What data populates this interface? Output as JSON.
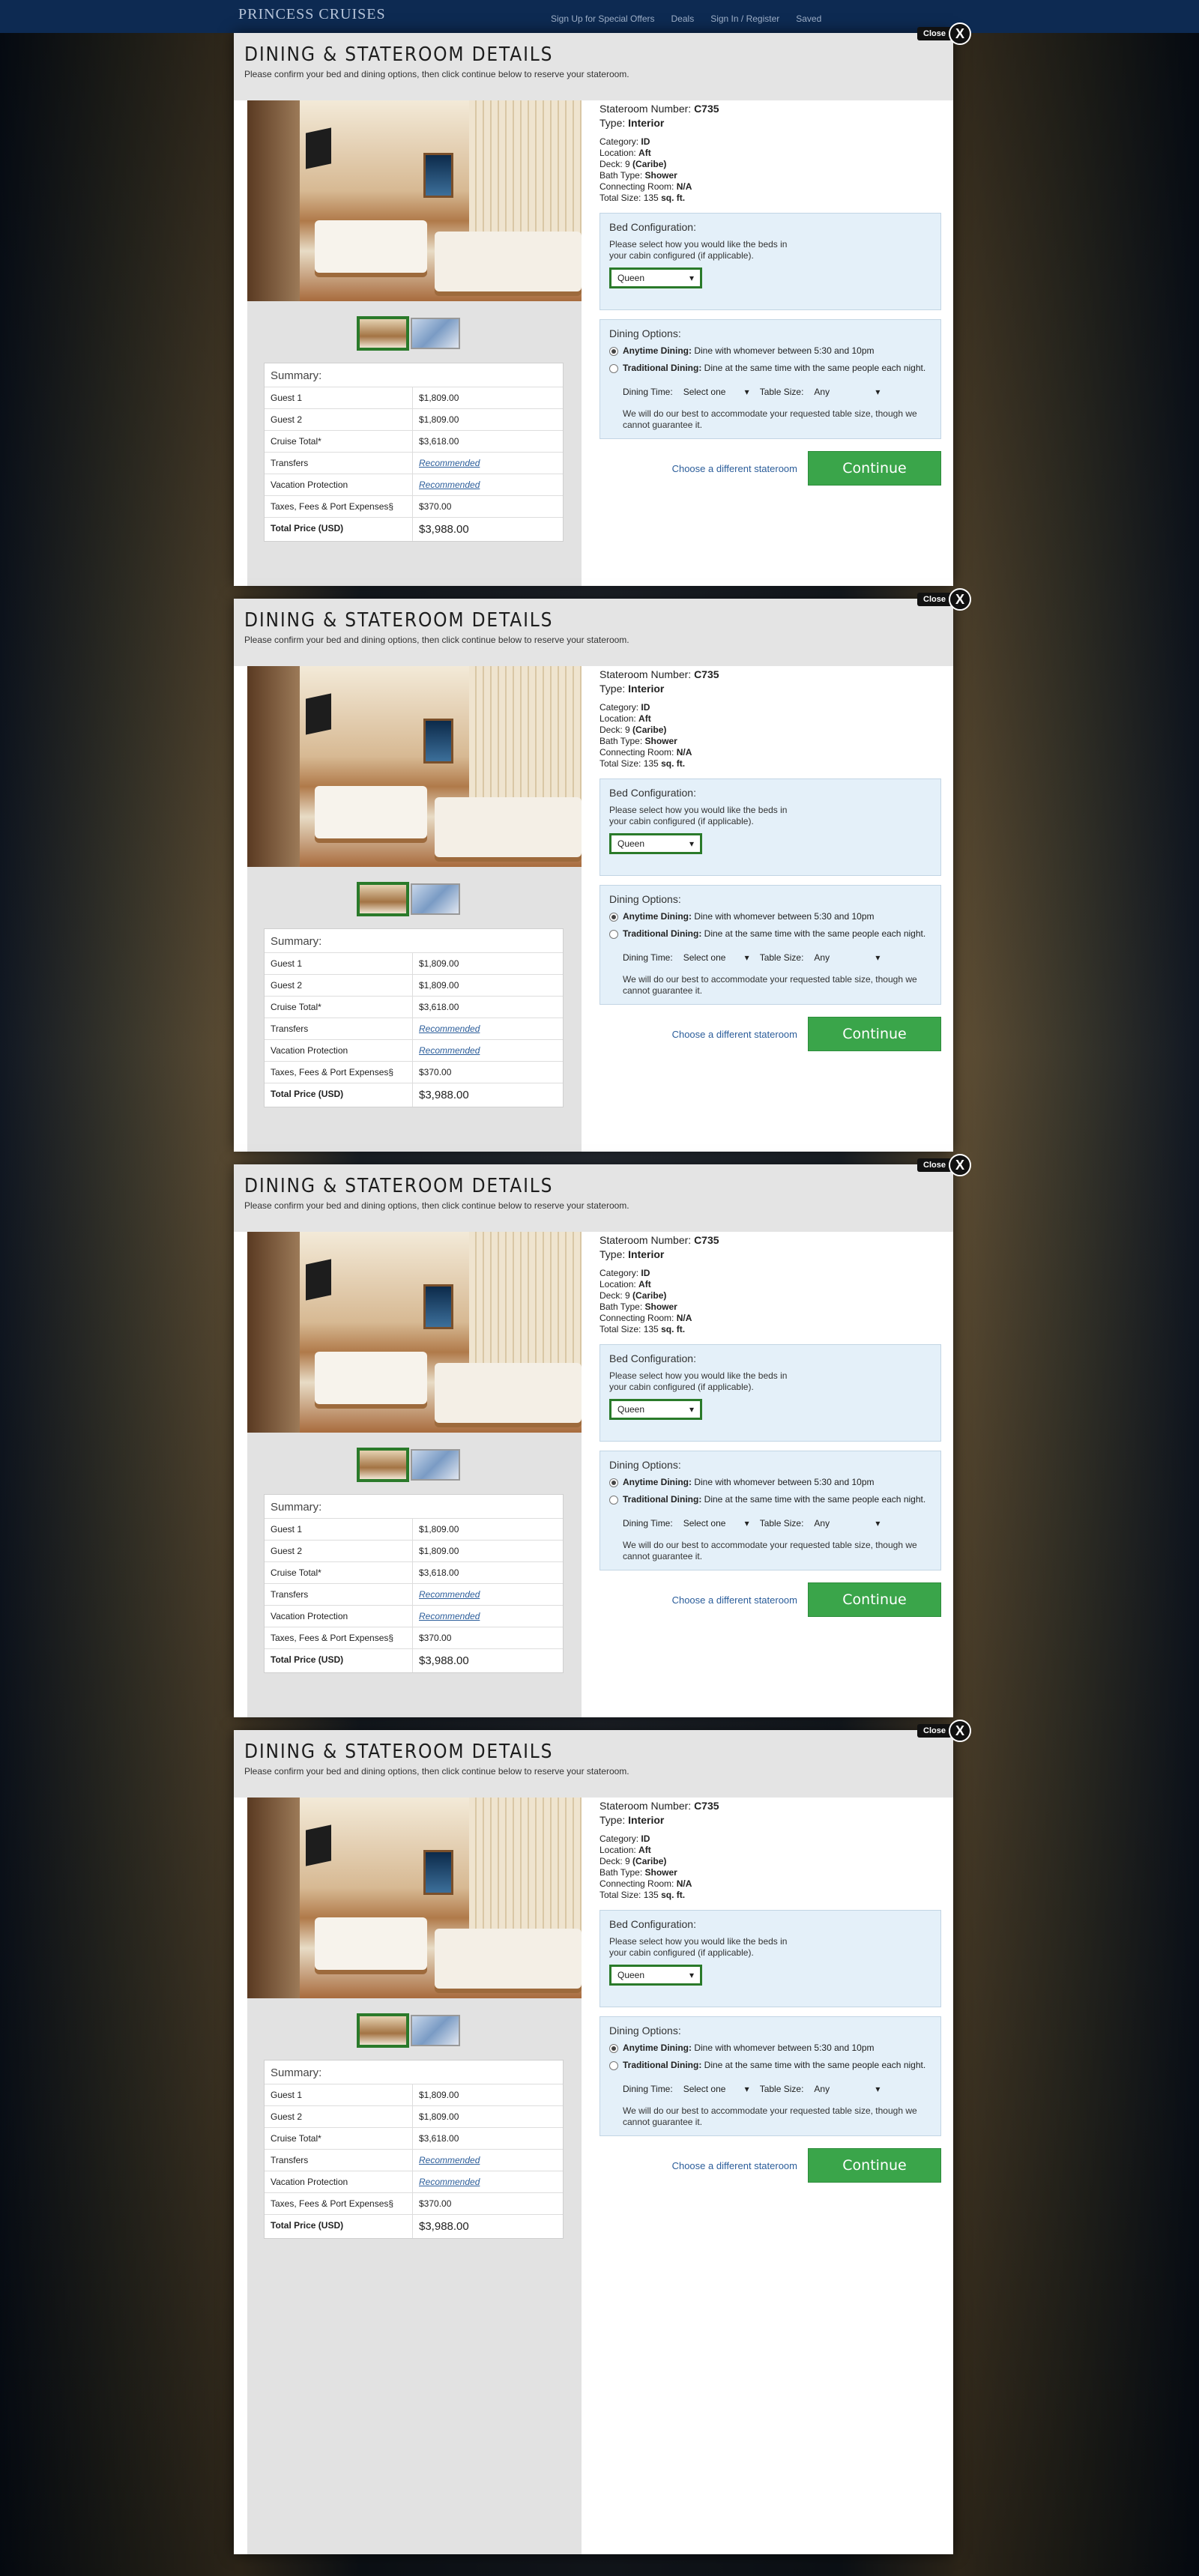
{
  "site": {
    "logo": "PRINCESS CRUISES",
    "links": [
      "Sign Up for Special Offers",
      "Deals",
      "Sign In / Register",
      "Saved"
    ]
  },
  "modal": {
    "title": "DINING & STATEROOM DETAILS",
    "subtitle": "Please confirm your bed and dining options, then click continue below to reserve your stateroom.",
    "close_label": "Close",
    "close_x": "X"
  },
  "stateroom": {
    "number_label": "Stateroom Number:",
    "number": "C735",
    "type_label": "Type:",
    "type": "Interior",
    "category_label": "Category:",
    "category": "ID",
    "location_label": "Location:",
    "location": "Aft",
    "deck_label": "Deck: 9",
    "deck": "(Caribe)",
    "bath_label": "Bath Type:",
    "bath": "Shower",
    "connecting_label": "Connecting Room:",
    "connecting": "N/A",
    "size_label": "Total Size: 135",
    "size_unit": "sq. ft."
  },
  "bed": {
    "heading": "Bed Configuration:",
    "text": "Please select how you would like the beds in your cabin configured (if applicable).",
    "selected": "Queen"
  },
  "dining": {
    "heading": "Dining Options:",
    "anytime_label": "Anytime Dining:",
    "anytime_text": "Dine with whomever between 5:30 and 10pm",
    "traditional_label": "Traditional Dining:",
    "traditional_text": "Dine at the same time with the same people each night.",
    "time_label": "Dining Time:",
    "time_value": "Select one",
    "table_label": "Table Size:",
    "table_value": "Any",
    "note": "We will do our best to accommodate your requested table size, though we cannot guarantee it."
  },
  "summary": {
    "title": "Summary:",
    "rows": [
      {
        "k": "Guest 1",
        "v": "$1,809.00"
      },
      {
        "k": "Guest 2",
        "v": "$1,809.00"
      },
      {
        "k": "Cruise Total*",
        "v": "$3,618.00"
      },
      {
        "k": "Transfers",
        "v": "Recommended"
      },
      {
        "k": "Vacation Protection",
        "v": "Recommended"
      },
      {
        "k": "Taxes, Fees & Port Expenses§",
        "v": "$370.00"
      },
      {
        "k": "Total Price (USD)",
        "v": "$3,988.00"
      }
    ]
  },
  "actions": {
    "alt": "Choose a different stateroom",
    "continue": "Continue"
  },
  "colors": {
    "accent_green": "#3aa54a",
    "select_border": "#2a7a2a",
    "panel_blue": "#e4f0f9",
    "link_blue": "#2b5d9a"
  }
}
